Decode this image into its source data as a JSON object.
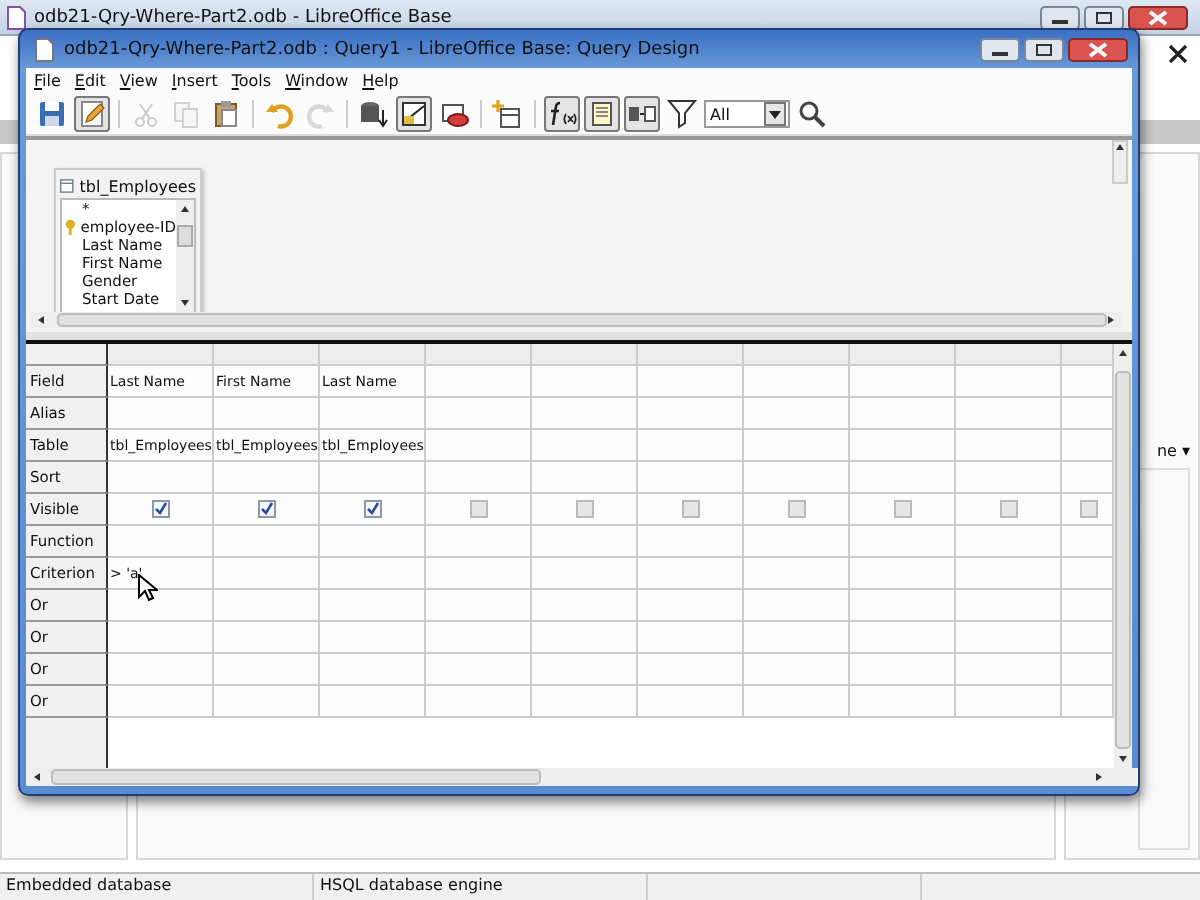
{
  "main_window": {
    "title": "odb21-Qry-Where-Part2.odb - LibreOffice Base",
    "side_fragment": "ne ▾"
  },
  "window": {
    "title": "odb21-Qry-Where-Part2.odb : Query1 - LibreOffice Base: Query Design"
  },
  "menu": [
    "File",
    "Edit",
    "View",
    "Insert",
    "Tools",
    "Window",
    "Help"
  ],
  "toolbar": {
    "limit": {
      "value": "All"
    },
    "buttons": [
      {
        "kind": "save",
        "on": false,
        "disabled": false
      },
      {
        "kind": "edit",
        "on": true,
        "disabled": false
      },
      {
        "kind": "sep"
      },
      {
        "kind": "cut",
        "on": false,
        "disabled": true
      },
      {
        "kind": "copy",
        "on": false,
        "disabled": true
      },
      {
        "kind": "paste",
        "on": false,
        "disabled": false
      },
      {
        "kind": "sep"
      },
      {
        "kind": "undo",
        "on": false,
        "disabled": false
      },
      {
        "kind": "redo",
        "on": false,
        "disabled": true
      },
      {
        "kind": "sep"
      },
      {
        "kind": "run",
        "on": false,
        "disabled": false
      },
      {
        "kind": "design",
        "on": true,
        "disabled": false
      },
      {
        "kind": "clear",
        "on": false,
        "disabled": false
      },
      {
        "kind": "sep"
      },
      {
        "kind": "addtable",
        "on": false,
        "disabled": false
      },
      {
        "kind": "sep"
      },
      {
        "kind": "functions",
        "on": true,
        "disabled": false
      },
      {
        "kind": "tablename",
        "on": true,
        "disabled": false
      },
      {
        "kind": "alias",
        "on": true,
        "disabled": false
      },
      {
        "kind": "distinct",
        "on": false,
        "disabled": false
      }
    ]
  },
  "table_box": {
    "title": "tbl_Employees",
    "fields": [
      {
        "name": "*",
        "key": false
      },
      {
        "name": "employee-ID",
        "key": true
      },
      {
        "name": "Last Name",
        "key": false
      },
      {
        "name": "First Name",
        "key": false
      },
      {
        "name": "Gender",
        "key": false
      },
      {
        "name": "Start Date",
        "key": false
      }
    ]
  },
  "grid": {
    "row_labels": [
      "Field",
      "Alias",
      "Table",
      "Sort",
      "Visible",
      "Function",
      "Criterion",
      "Or",
      "Or",
      "Or",
      "Or"
    ],
    "columns": [
      {
        "field": "Last Name",
        "table": "tbl_Employees",
        "visible": true,
        "criterion": "> 'a'"
      },
      {
        "field": "First Name",
        "table": "tbl_Employees",
        "visible": true
      },
      {
        "field": "Last Name",
        "table": "tbl_Employees",
        "visible": true
      },
      {
        "visible": false
      },
      {
        "visible": false
      },
      {
        "visible": false
      },
      {
        "visible": false
      },
      {
        "visible": false
      },
      {
        "visible": false
      },
      {
        "visible": false
      }
    ]
  },
  "status_bar": [
    "Embedded database",
    "HSQL database engine"
  ]
}
